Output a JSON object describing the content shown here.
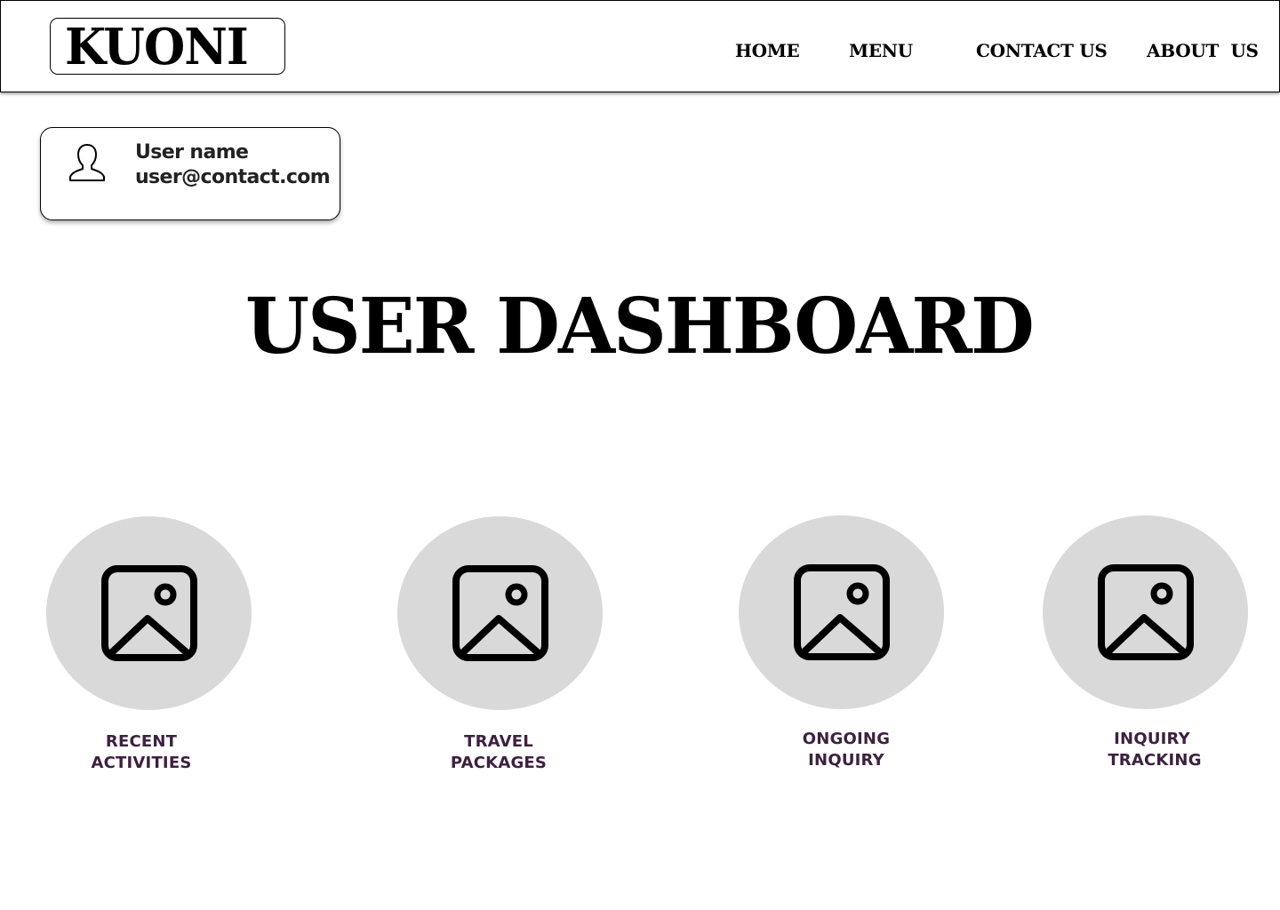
{
  "header": {
    "logo_text": "KUONI",
    "nav": {
      "home": "HOME",
      "menu": "MENU",
      "contact": "CONTACT US",
      "about": "ABOUT  US"
    }
  },
  "user_card": {
    "name": "User name",
    "email": "user@contact.com",
    "icon": "user-silhouette-icon"
  },
  "main": {
    "title": "USER DASHBOARD",
    "tiles": [
      {
        "line1": "RECENT",
        "line2": "ACTIVITIES",
        "icon": "image-icon"
      },
      {
        "line1": "TRAVEL",
        "line2": "PACKAGES",
        "icon": "image-icon"
      },
      {
        "line1": "ONGOING",
        "line2": "INQUIRY",
        "icon": "image-icon"
      },
      {
        "line1": "INQUIRY",
        "line2": "TRACKING",
        "icon": "image-icon"
      }
    ]
  },
  "colors": {
    "tile_background": "#d9d9d9",
    "tile_label": "#3d2140",
    "text": "#000000"
  }
}
